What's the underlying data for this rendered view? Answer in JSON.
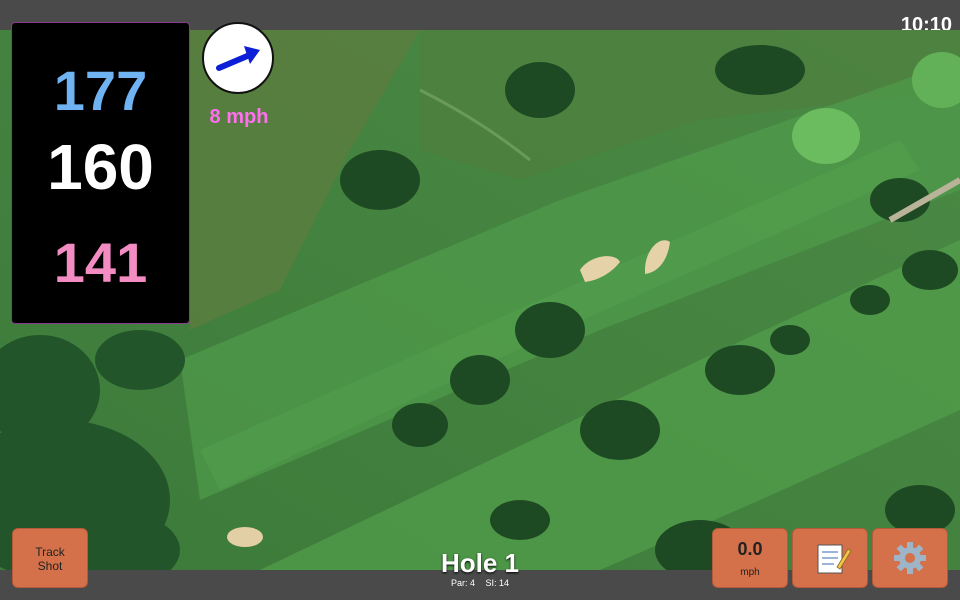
{
  "status": {
    "time": "10:10"
  },
  "distances": {
    "back": "177",
    "middle": "160",
    "front": "141"
  },
  "wind": {
    "speed": "8 mph",
    "arrow_icon": "wind-arrow-icon"
  },
  "hole": {
    "title": "Hole 1",
    "par_label": "Par: 4",
    "si_label": "SI: 14"
  },
  "buttons": {
    "track_shot_line1": "Track",
    "track_shot_line2": "Shot",
    "speed_value": "0.0",
    "speed_unit": "mph",
    "notes_icon": "notepad-icon",
    "settings_icon": "gear-icon"
  },
  "colors": {
    "back_distance": "#6fb3f2",
    "middle_distance": "#ffffff",
    "front_distance": "#f48cc4",
    "wind_text": "#ff6ff0",
    "button_bg": "#d4714a"
  }
}
